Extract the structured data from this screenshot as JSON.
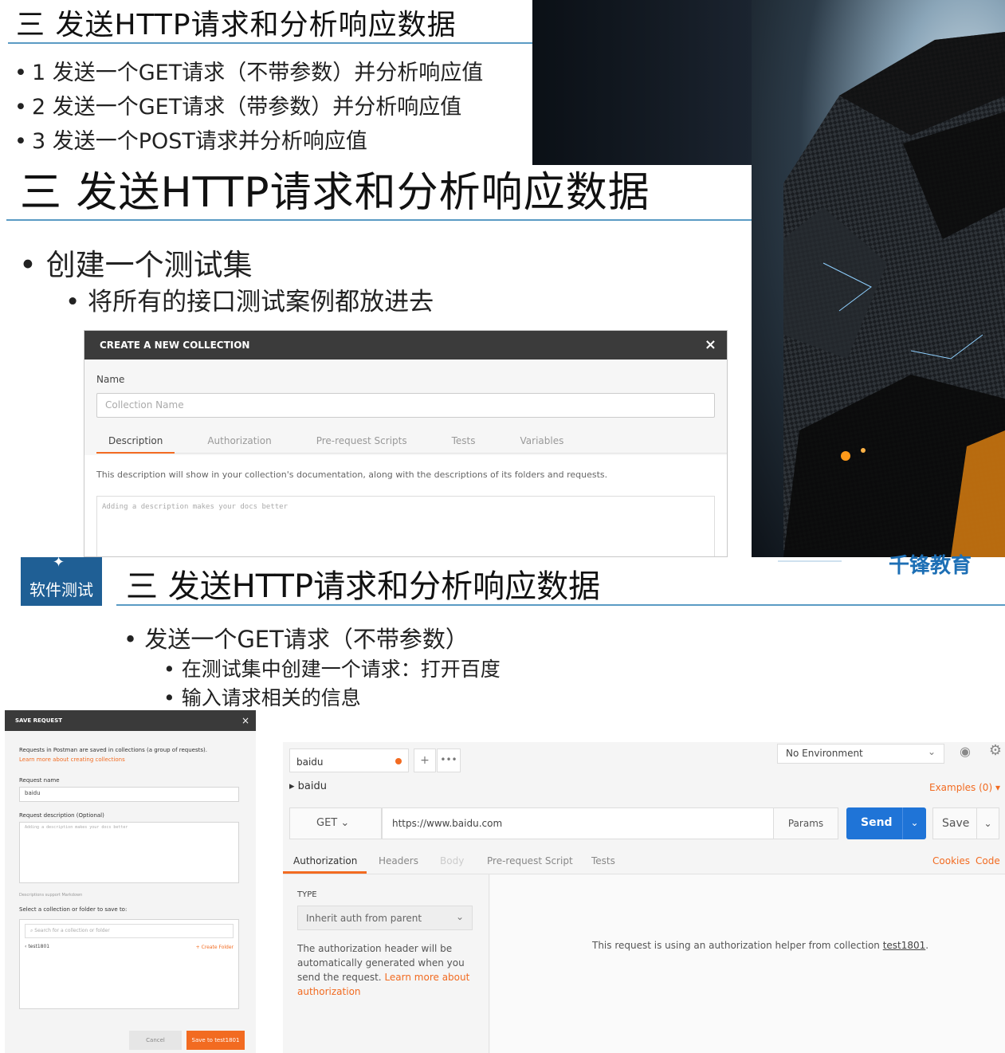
{
  "slide1": {
    "title": "三  发送HTTP请求和分析响应数据",
    "items": [
      "1  发送一个GET请求（不带参数）并分析响应值",
      "2  发送一个GET请求（带参数）并分析响应值",
      "3  发送一个POST请求并分析响应值"
    ]
  },
  "slide2": {
    "title": "三  发送HTTP请求和分析响应数据",
    "bullet1": "创建一个测试集",
    "bullet2": "将所有的接口测试案例都放进去",
    "dialog": {
      "header": "CREATE A NEW COLLECTION",
      "close": "×",
      "name_label": "Name",
      "name_placeholder": "Collection Name",
      "tabs": [
        "Description",
        "Authorization",
        "Pre-request Scripts",
        "Tests",
        "Variables"
      ],
      "description_help": "This description will show in your collection's documentation, along with the descriptions of its folders and requests.",
      "description_placeholder": "Adding a description makes your docs better"
    }
  },
  "slide3": {
    "logo_text": "软件测试",
    "brand": "千锋教育",
    "title": "三  发送HTTP请求和分析响应数据",
    "bullet1": "发送一个GET请求（不带参数）",
    "bullet2": "在测试集中创建一个请求：打开百度",
    "bullet3": "输入请求相关的信息"
  },
  "save_request": {
    "header": "SAVE REQUEST",
    "close": "×",
    "intro": "Requests in Postman are saved in collections (a group of requests).",
    "learn_link": "Learn more about creating collections",
    "name_label": "Request name",
    "name_value": "baidu",
    "desc_label": "Request description (Optional)",
    "desc_placeholder": "Adding a description makes your docs better",
    "markdown_note": "Descriptions support Markdown",
    "select_label": "Select a collection or folder to save to:",
    "search_placeholder": "Search for a collection or folder",
    "collection": "test1801",
    "create_folder": "+ Create Folder",
    "cancel": "Cancel",
    "save": "Save to test1801"
  },
  "postman": {
    "tab_name": "baidu",
    "plus": "+",
    "more": "•••",
    "environment": "No Environment",
    "request_name": "baidu",
    "examples": "Examples (0)",
    "method": "GET",
    "url": "https://www.baidu.com",
    "params": "Params",
    "send": "Send",
    "save": "Save",
    "tabs": [
      "Authorization",
      "Headers",
      "Body",
      "Pre-request Script",
      "Tests"
    ],
    "cookies": "Cookies",
    "code": "Code",
    "type_label": "TYPE",
    "type_value": "Inherit auth from parent",
    "help_text": "The authorization header will be automatically generated when you send the request. ",
    "help_link": "Learn more about authorization",
    "right_text": "This request is using an authorization helper from collection ",
    "right_link": "test1801",
    "right_end": ".",
    "accent": "#f26b21",
    "send_color": "#1f74d7"
  }
}
